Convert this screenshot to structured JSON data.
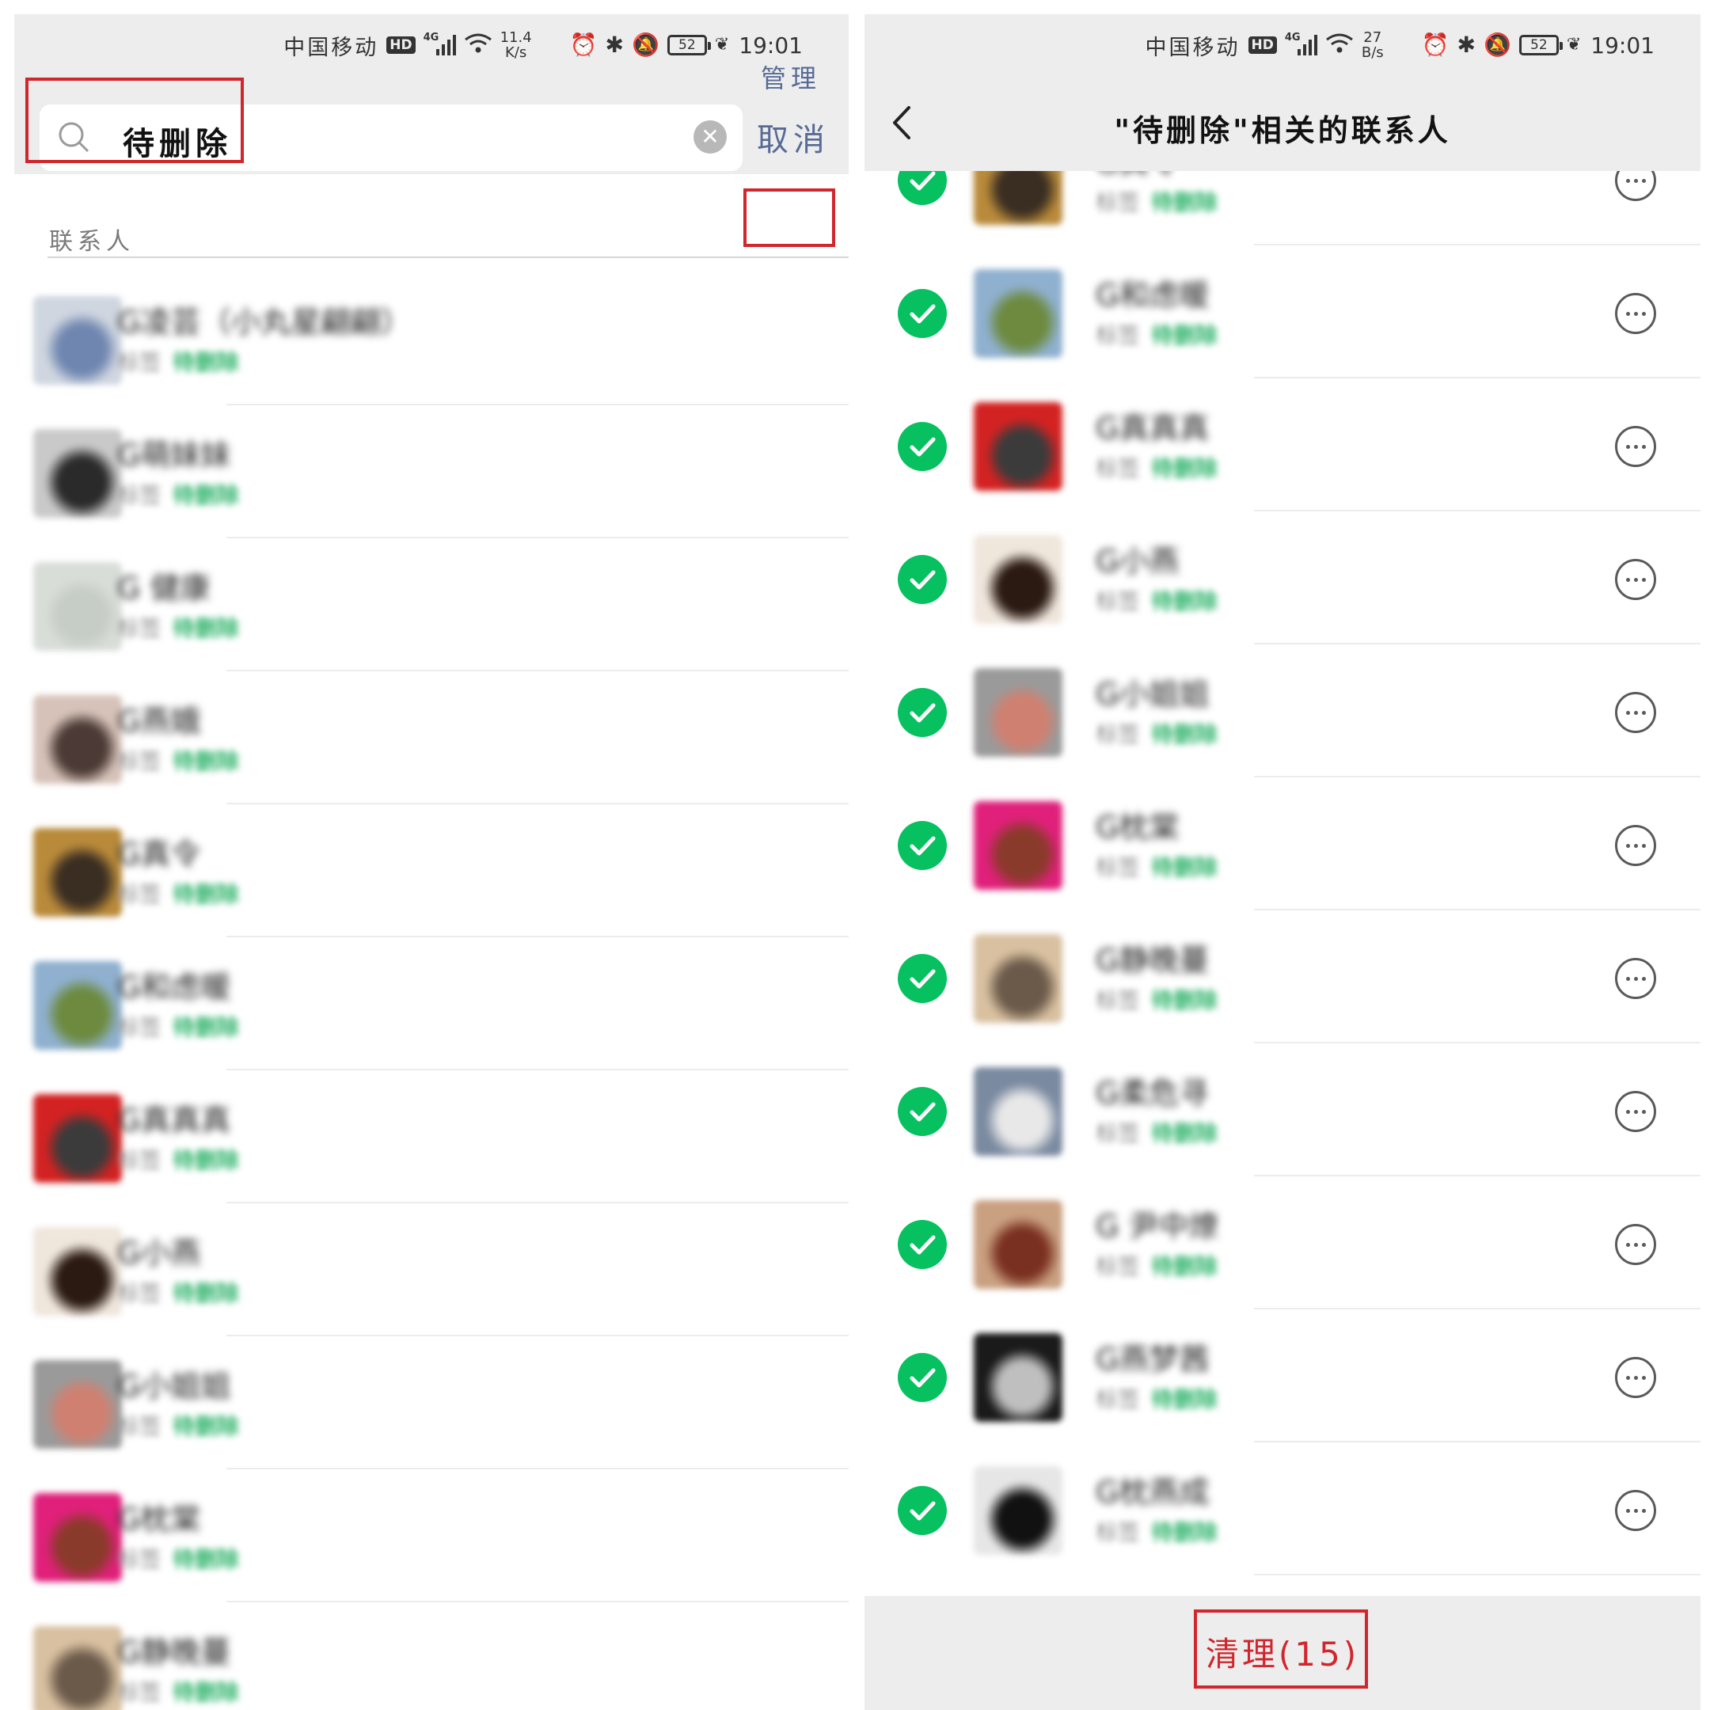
{
  "left_screen": {
    "status_bar": {
      "carrier": "中国移动",
      "hd": "HD",
      "network": "4G",
      "speed_value": "11.4",
      "speed_unit": "K/s",
      "battery": "52",
      "time": "19:01"
    },
    "search": {
      "query": "待删除",
      "cancel_label": "取消"
    },
    "section": {
      "label": "联系人",
      "manage_label": "管理"
    },
    "contacts": [
      {
        "name": "G凌芸（小丸星翩翩）",
        "sub_a": "标签",
        "sub_b": "待删除",
        "avatar_colors": [
          "#cfd6e0",
          "#6f86b0"
        ]
      },
      {
        "name": "G萌妹妹",
        "sub_a": "标签",
        "sub_b": "待删除",
        "avatar_colors": [
          "#c9c9c9",
          "#2a2a2a"
        ]
      },
      {
        "name": "G 健康",
        "sub_a": "标签",
        "sub_b": "待删除",
        "avatar_colors": [
          "#d8ddd8",
          "#c6ccc6"
        ]
      },
      {
        "name": "G燕娥",
        "sub_a": "标签",
        "sub_b": "待删除",
        "avatar_colors": [
          "#d6c2b8",
          "#4b3a35"
        ]
      },
      {
        "name": "G真令",
        "sub_a": "标签",
        "sub_b": "待删除",
        "avatar_colors": [
          "#b98a3a",
          "#3a2e22"
        ]
      },
      {
        "name": "G和虑暖",
        "sub_a": "标签",
        "sub_b": "待删除",
        "avatar_colors": [
          "#8fb0cf",
          "#6d8a3e"
        ]
      },
      {
        "name": "G真真真",
        "sub_a": "标签",
        "sub_b": "待删除",
        "avatar_colors": [
          "#d32222",
          "#3b3b3b"
        ]
      },
      {
        "name": "G小燕",
        "sub_a": "标签",
        "sub_b": "待删除",
        "avatar_colors": [
          "#efe6dc",
          "#2b1a12"
        ]
      },
      {
        "name": "G小姐姐",
        "sub_a": "标签",
        "sub_b": "待删除",
        "avatar_colors": [
          "#9a9a9a",
          "#d08070"
        ]
      },
      {
        "name": "G枕棠",
        "sub_a": "标签",
        "sub_b": "待删除",
        "avatar_colors": [
          "#e0207a",
          "#8a3a2a"
        ]
      },
      {
        "name": "G静晚蔓",
        "sub_a": "标签",
        "sub_b": "待删除",
        "avatar_colors": [
          "#d8c0a0",
          "#6b5a4a"
        ]
      }
    ]
  },
  "right_screen": {
    "status_bar": {
      "carrier": "中国移动",
      "hd": "HD",
      "network": "4G",
      "speed_value": "27",
      "speed_unit": "B/s",
      "battery": "52",
      "time": "19:01"
    },
    "title": "\"待删除\"相关的联系人",
    "contacts": [
      {
        "name": "G真令",
        "sub_a": "标签",
        "sub_b": "待删除",
        "avatar_colors": [
          "#b98a3a",
          "#3a2e22"
        ]
      },
      {
        "name": "G和虑暖",
        "sub_a": "标签",
        "sub_b": "待删除",
        "avatar_colors": [
          "#8fb0cf",
          "#6d8a3e"
        ]
      },
      {
        "name": "G真真真",
        "sub_a": "标签",
        "sub_b": "待删除",
        "avatar_colors": [
          "#d32222",
          "#3b3b3b"
        ]
      },
      {
        "name": "G小燕",
        "sub_a": "标签",
        "sub_b": "待删除",
        "avatar_colors": [
          "#efe6dc",
          "#2b1a12"
        ]
      },
      {
        "name": "G小姐姐",
        "sub_a": "标签",
        "sub_b": "待删除",
        "avatar_colors": [
          "#9a9a9a",
          "#d08070"
        ]
      },
      {
        "name": "G枕棠",
        "sub_a": "标签",
        "sub_b": "待删除",
        "avatar_colors": [
          "#e0207a",
          "#8a3a2a"
        ]
      },
      {
        "name": "G静晚蔓",
        "sub_a": "标签",
        "sub_b": "待删除",
        "avatar_colors": [
          "#d8c0a0",
          "#6b5a4a"
        ]
      },
      {
        "name": "G柔危寻",
        "sub_a": "标签",
        "sub_b": "待删除",
        "avatar_colors": [
          "#7a8aa0",
          "#e8e8e8"
        ]
      },
      {
        "name": "G 尹中燎",
        "sub_a": "标签",
        "sub_b": "待删除",
        "avatar_colors": [
          "#c9a080",
          "#7a3020"
        ]
      },
      {
        "name": "G燕梦茜",
        "sub_a": "标签",
        "sub_b": "待删除",
        "avatar_colors": [
          "#1a1a1a",
          "#bfbfbf"
        ]
      },
      {
        "name": "G枕燕成",
        "sub_a": "标签",
        "sub_b": "待删除",
        "avatar_colors": [
          "#e6e6e6",
          "#111111"
        ]
      }
    ],
    "clean_label": "清理(15)"
  },
  "colors": {
    "highlight": "#d0262d",
    "wechat_green": "#07c160",
    "link_blue": "#576b95",
    "header_gray": "#ededed"
  }
}
